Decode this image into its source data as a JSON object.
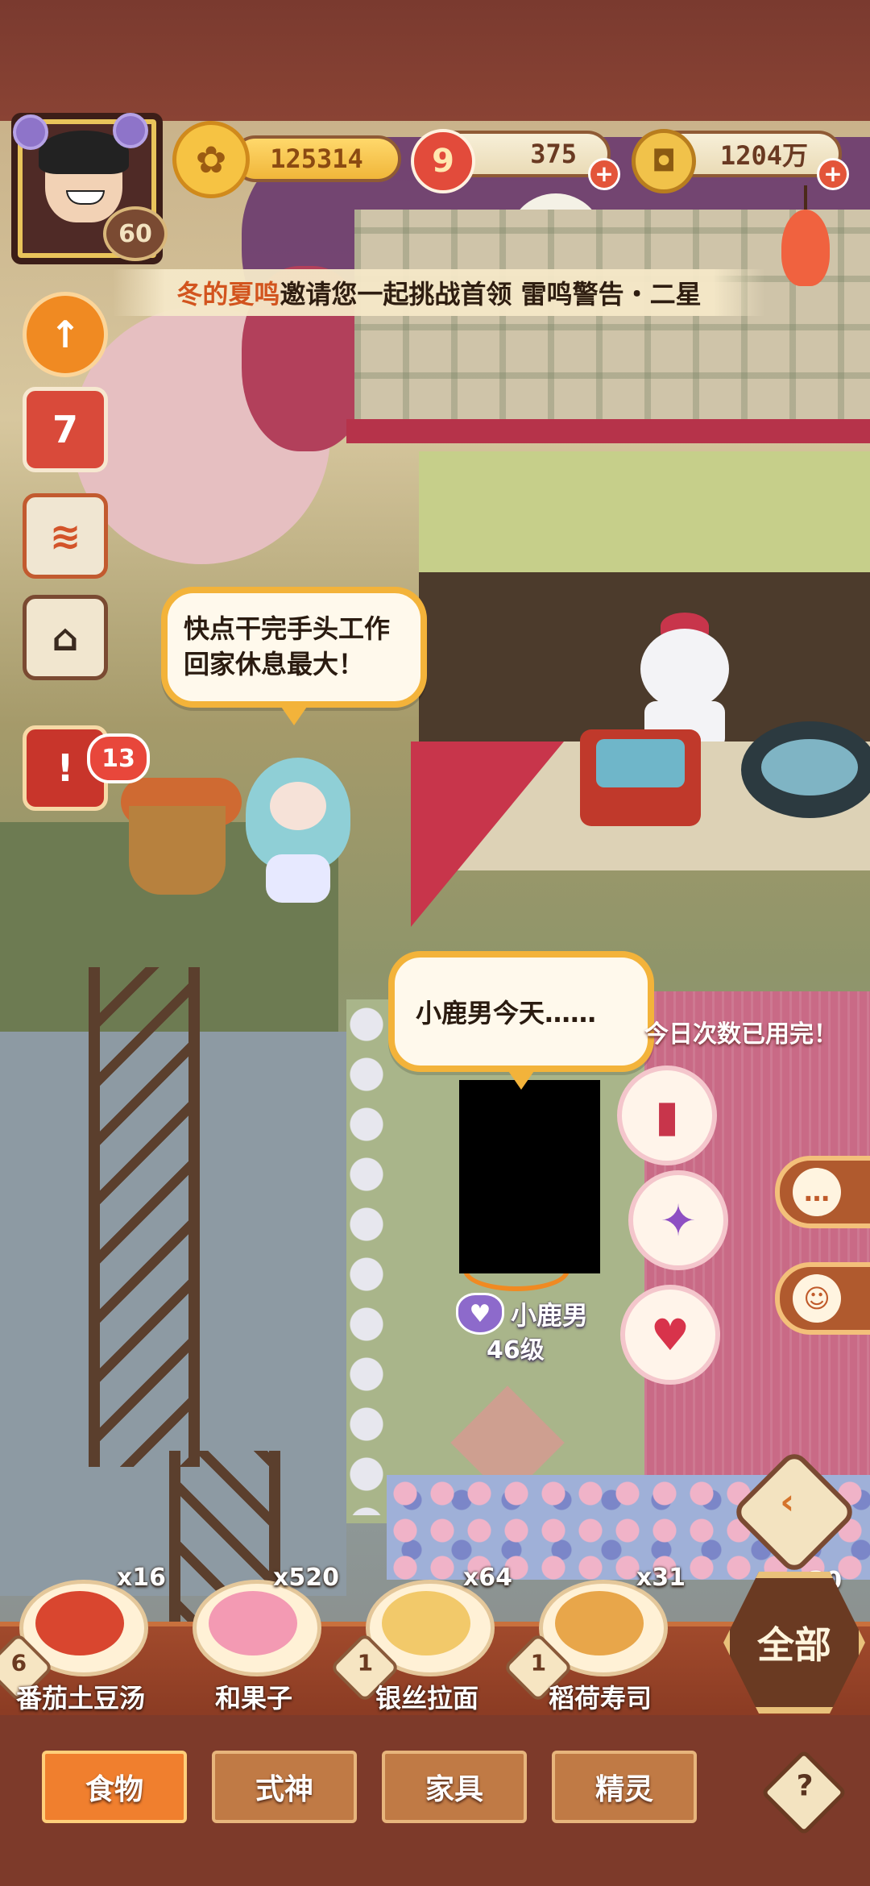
{
  "hud": {
    "player_level": "60",
    "resources": {
      "gold_talisman": "125314",
      "jade": "375",
      "coins": "1204万"
    }
  },
  "banner": {
    "player": "冬的夏鸣",
    "message": "邀请您一起挑战首领 雷鸣警告・二星"
  },
  "side_menu": {
    "calendar_day": "7",
    "notification_count": "13"
  },
  "npc": {
    "speech": "快点干完手头工作回家休息最大！"
  },
  "player": {
    "speech": "小鹿男今天……",
    "name": "小鹿男",
    "level": "46级",
    "daily_limit_text": "今日次数已用完！"
  },
  "foods": [
    {
      "name": "番茄土豆汤",
      "count": "x16",
      "badge": "6",
      "color": "#d9462f"
    },
    {
      "name": "和果子",
      "count": "x520",
      "badge": "",
      "color": "#f39ab3"
    },
    {
      "name": "银丝拉面",
      "count": "x64",
      "badge": "1",
      "color": "#f2c96a"
    },
    {
      "name": "稻荷寿司",
      "count": "x31",
      "badge": "1",
      "color": "#e8a64a"
    }
  ],
  "all_button": {
    "label": "全部",
    "count": "x30"
  },
  "tabs": [
    "食物",
    "式神",
    "家具",
    "精灵"
  ],
  "help_label": "?"
}
